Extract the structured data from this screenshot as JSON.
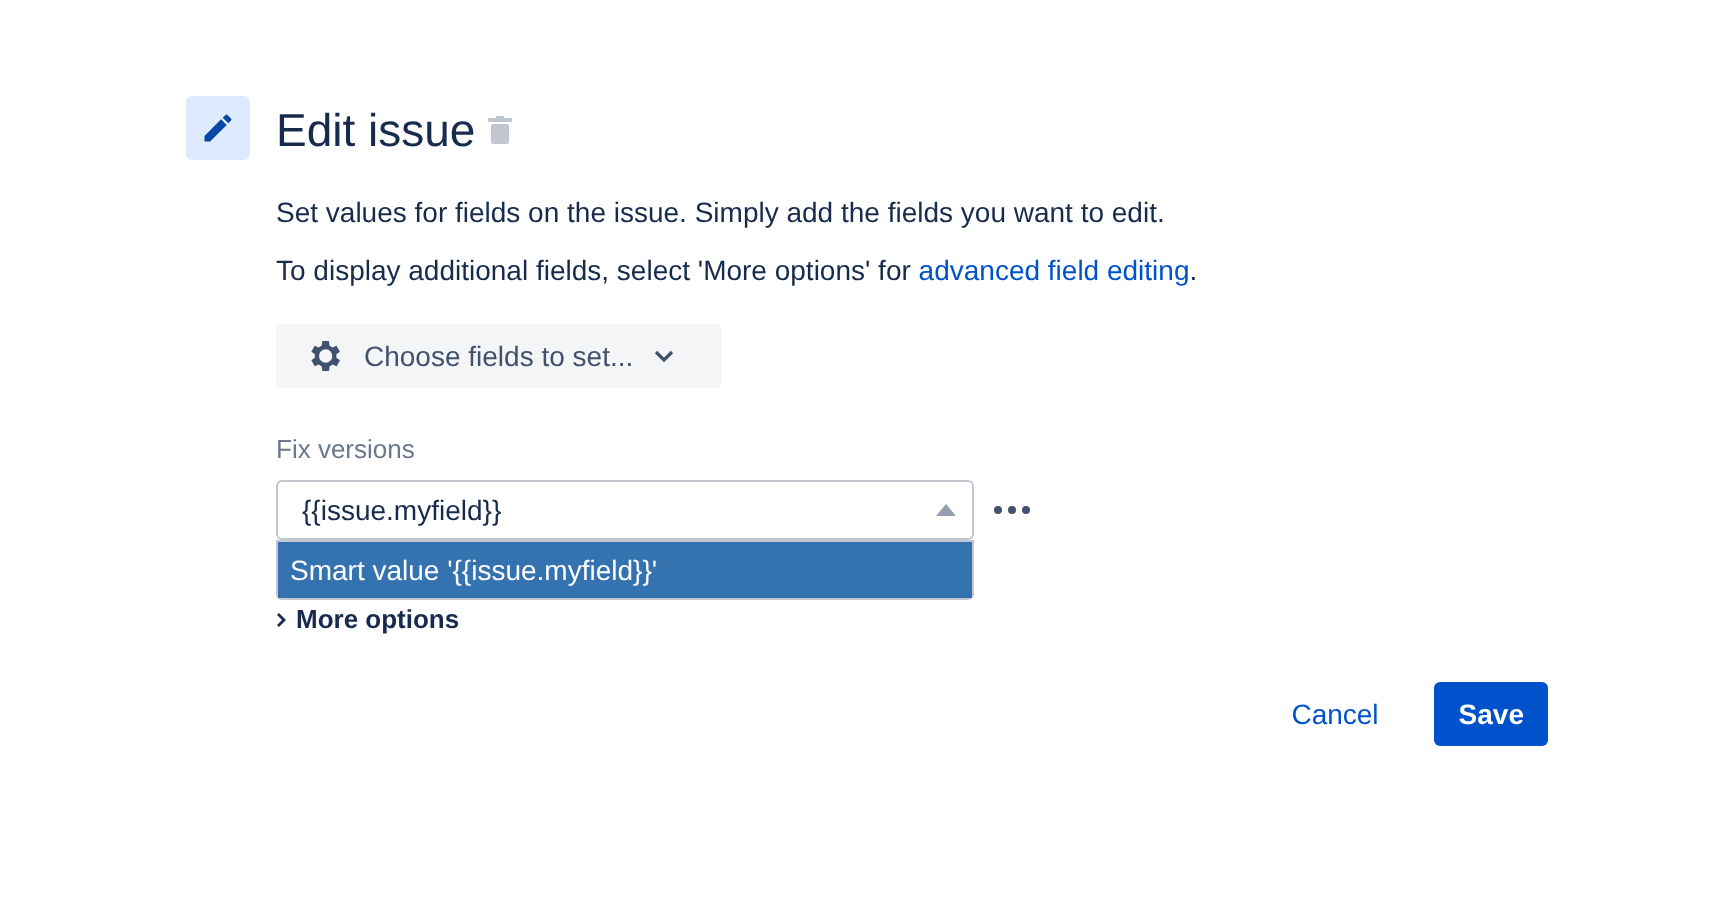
{
  "header": {
    "title": "Edit issue"
  },
  "description": "Set values for fields on the issue. Simply add the fields you want to edit.",
  "hint": {
    "text": "To display additional fields, select 'More options' for ",
    "link": "advanced field editing",
    "end": "."
  },
  "choose_button": "Choose fields to set...",
  "field": {
    "label": "Fix versions",
    "value": "{{issue.myfield}}",
    "suggestions": [
      {
        "text": "Smart value '{{issue.myfield}}'",
        "selected": true
      }
    ]
  },
  "more_options": {
    "label": "More options"
  },
  "buttons": [
    {
      "kind": "link",
      "label": "Cancel"
    },
    {
      "kind": "primary",
      "label": "Save"
    }
  ]
}
